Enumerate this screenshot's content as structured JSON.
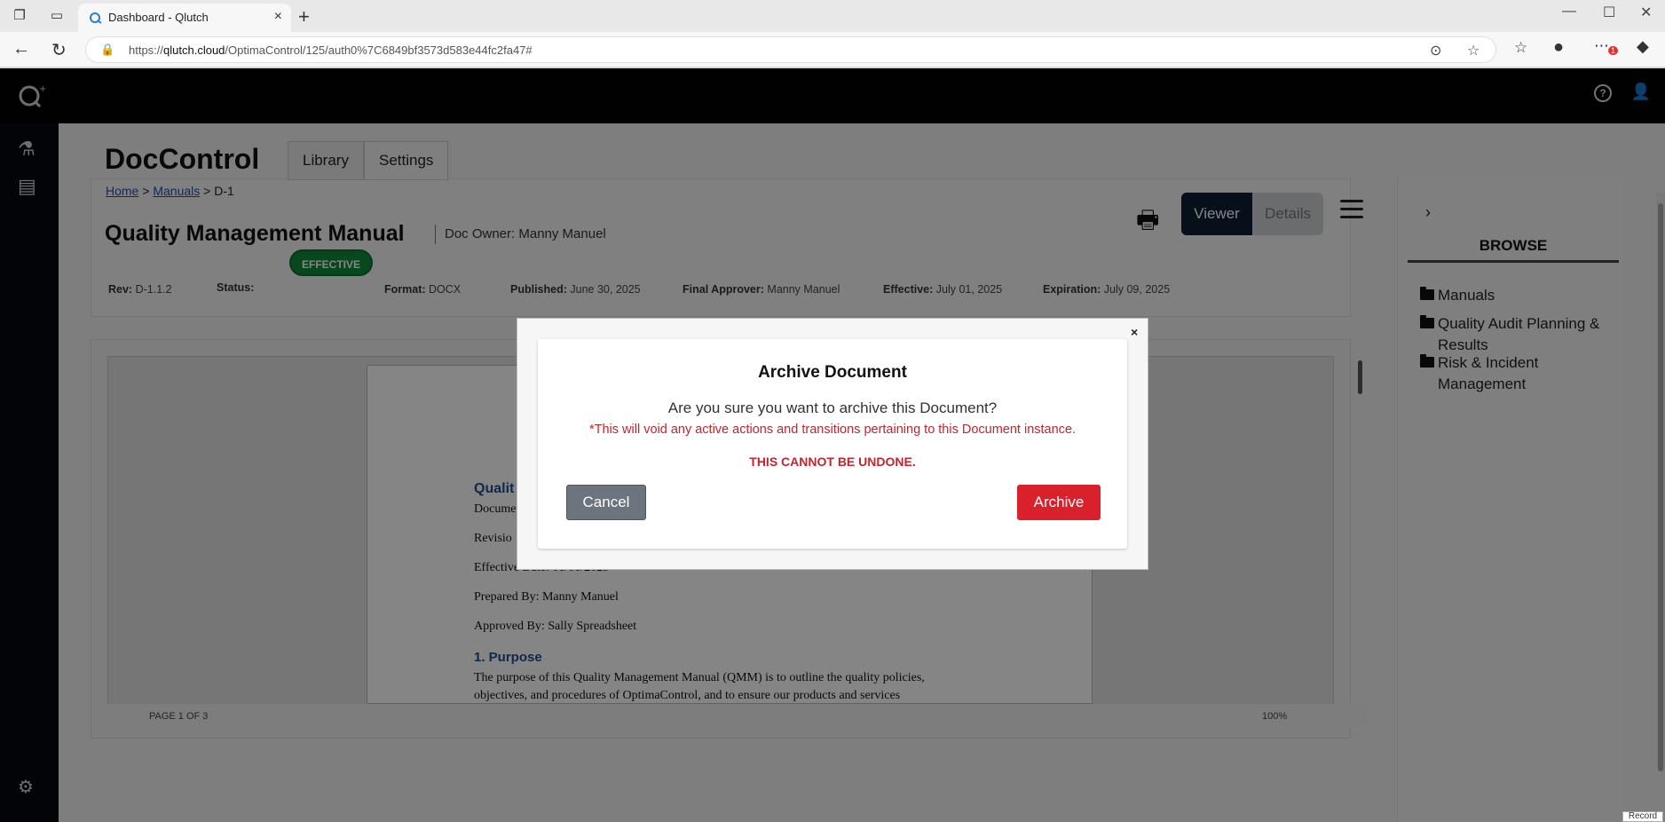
{
  "browser": {
    "tab_title": "Dashboard - Qlutch",
    "url_prefix": "https://",
    "url_host": "qlutch.cloud",
    "url_path": "/OptimaControl/125/auth0%7C6849bf3573d583e44fc2fa47#",
    "notification_count": "1"
  },
  "app": {
    "title": "DocControl",
    "tabs": [
      {
        "label": "Library"
      },
      {
        "label": "Settings"
      }
    ],
    "breadcrumb": {
      "home": "Home",
      "manuals": "Manuals",
      "sep": ">",
      "current": "D-1"
    }
  },
  "document": {
    "title": "Quality Management Manual",
    "owner": "Doc Owner: Manny Manuel",
    "view_buttons": {
      "viewer": "Viewer",
      "details": "Details"
    },
    "meta": {
      "rev_label": "Rev:",
      "rev": "D-1.1.2",
      "status_label": "Status:",
      "status": "EFFECTIVE",
      "format_label": "Format:",
      "format": "DOCX",
      "published_label": "Published:",
      "published": "June 30, 2025",
      "approver_label": "Final Approver:",
      "approver": "Manny Manuel",
      "effective_label": "Effective:",
      "effective": "July 01, 2025",
      "expiration_label": "Expiration:",
      "expiration": "July 09, 2025"
    },
    "page": {
      "heading": "Qualit",
      "line_doc": "Docume",
      "line_rev": "Revisio",
      "line_eff": "Effective Date: 01/01/2025",
      "prepared": "Prepared By: Manny Manuel",
      "approved": "Approved By: Sally Spreadsheet",
      "section_1": "1. Purpose",
      "para_1": "The purpose of this Quality Management Manual (QMM) is to outline the quality policies,",
      "para_2": "objectives, and procedures of OptimaControl, and to ensure our products and services"
    },
    "footer": {
      "page": "PAGE 1 OF 3",
      "zoom": "100%"
    }
  },
  "browse": {
    "title": "BROWSE",
    "items": [
      {
        "label": "Manuals"
      },
      {
        "label": "Quality Audit Planning & Results"
      },
      {
        "label": "Risk & Incident Management"
      }
    ]
  },
  "modal": {
    "title": "Archive Document",
    "question": "Are you sure you want to archive this Document?",
    "warning": "*This will void any active actions and transitions pertaining to this Document instance.",
    "final": "THIS CANNOT BE UNDONE.",
    "cancel_label": "Cancel",
    "archive_label": "Archive",
    "close_label": "×"
  },
  "misc": {
    "record_label": "Record"
  }
}
